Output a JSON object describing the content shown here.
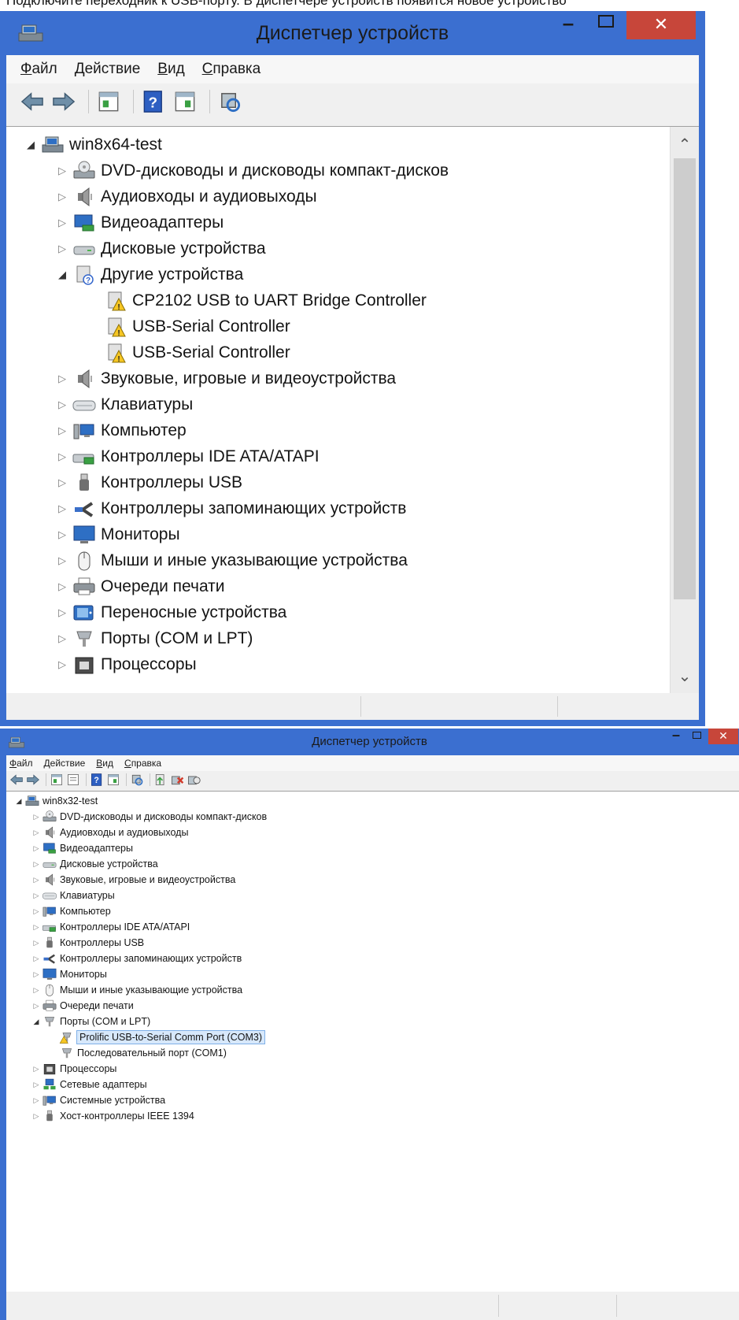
{
  "windows": [
    {
      "title": "Диспетчер устройств",
      "menu": [
        "Файл",
        "Действие",
        "Вид",
        "Справка"
      ],
      "toolbar": [
        "back-icon",
        "forward-icon",
        "sep",
        "properties-grid-icon",
        "sep",
        "help-icon",
        "view-grid-icon",
        "sep",
        "scan-hardware-icon"
      ],
      "tree": [
        {
          "label": "win8x64-test",
          "level": 0,
          "expanded": true,
          "icon": "computer-icon"
        },
        {
          "label": "DVD-дисководы и дисководы компакт-дисков",
          "level": 1,
          "expanded": false,
          "icon": "dvd-drive-icon"
        },
        {
          "label": "Аудиовходы и аудиовыходы",
          "level": 1,
          "expanded": false,
          "icon": "speaker-icon"
        },
        {
          "label": "Видеоадаптеры",
          "level": 1,
          "expanded": false,
          "icon": "display-adapter-icon"
        },
        {
          "label": "Дисковые устройства",
          "level": 1,
          "expanded": false,
          "icon": "disk-drive-icon"
        },
        {
          "label": "Другие устройства",
          "level": 1,
          "expanded": true,
          "icon": "unknown-device-icon"
        },
        {
          "label": "CP2102 USB to UART Bridge Controller",
          "level": 2,
          "expanded": null,
          "icon": "warning-device-icon"
        },
        {
          "label": "USB-Serial Controller",
          "level": 2,
          "expanded": null,
          "icon": "warning-device-icon"
        },
        {
          "label": "USB-Serial Controller",
          "level": 2,
          "expanded": null,
          "icon": "warning-device-icon"
        },
        {
          "label": "Звуковые, игровые и видеоустройства",
          "level": 1,
          "expanded": false,
          "icon": "speaker-icon"
        },
        {
          "label": "Клавиатуры",
          "level": 1,
          "expanded": false,
          "icon": "keyboard-icon"
        },
        {
          "label": "Компьютер",
          "level": 1,
          "expanded": false,
          "icon": "computer-small-icon"
        },
        {
          "label": "Контроллеры IDE ATA/ATAPI",
          "level": 1,
          "expanded": false,
          "icon": "ide-controller-icon"
        },
        {
          "label": "Контроллеры USB",
          "level": 1,
          "expanded": false,
          "icon": "usb-plug-icon"
        },
        {
          "label": "Контроллеры запоминающих устройств",
          "level": 1,
          "expanded": false,
          "icon": "storage-controller-icon"
        },
        {
          "label": "Мониторы",
          "level": 1,
          "expanded": false,
          "icon": "monitor-icon"
        },
        {
          "label": "Мыши и иные указывающие устройства",
          "level": 1,
          "expanded": false,
          "icon": "mouse-icon"
        },
        {
          "label": "Очереди печати",
          "level": 1,
          "expanded": false,
          "icon": "printer-icon"
        },
        {
          "label": "Переносные устройства",
          "level": 1,
          "expanded": false,
          "icon": "portable-device-icon"
        },
        {
          "label": "Порты (COM и LPT)",
          "level": 1,
          "expanded": false,
          "icon": "port-icon"
        },
        {
          "label": "Процессоры",
          "level": 1,
          "expanded": false,
          "icon": "processor-icon"
        }
      ]
    },
    {
      "title": "Диспетчер устройств",
      "menu": [
        "Файл",
        "Действие",
        "Вид",
        "Справка"
      ],
      "toolbar": [
        "back-icon",
        "forward-icon",
        "sep",
        "properties-grid-icon",
        "list-icon",
        "sep",
        "help-icon",
        "view-grid-icon",
        "sep",
        "scan-hardware-icon",
        "sep",
        "update-driver-icon",
        "uninstall-device-icon",
        "enable-device-icon"
      ],
      "tree": [
        {
          "label": "win8x32-test",
          "level": 0,
          "expanded": true,
          "icon": "computer-icon"
        },
        {
          "label": "DVD-дисководы и дисководы компакт-дисков",
          "level": 1,
          "expanded": false,
          "icon": "dvd-drive-icon"
        },
        {
          "label": "Аудиовходы и аудиовыходы",
          "level": 1,
          "expanded": false,
          "icon": "speaker-icon"
        },
        {
          "label": "Видеоадаптеры",
          "level": 1,
          "expanded": false,
          "icon": "display-adapter-icon"
        },
        {
          "label": "Дисковые устройства",
          "level": 1,
          "expanded": false,
          "icon": "disk-drive-icon"
        },
        {
          "label": "Звуковые, игровые и видеоустройства",
          "level": 1,
          "expanded": false,
          "icon": "speaker-icon"
        },
        {
          "label": "Клавиатуры",
          "level": 1,
          "expanded": false,
          "icon": "keyboard-icon"
        },
        {
          "label": "Компьютер",
          "level": 1,
          "expanded": false,
          "icon": "computer-small-icon"
        },
        {
          "label": "Контроллеры IDE ATA/ATAPI",
          "level": 1,
          "expanded": false,
          "icon": "ide-controller-icon"
        },
        {
          "label": "Контроллеры USB",
          "level": 1,
          "expanded": false,
          "icon": "usb-plug-icon"
        },
        {
          "label": "Контроллеры запоминающих устройств",
          "level": 1,
          "expanded": false,
          "icon": "storage-controller-icon"
        },
        {
          "label": "Мониторы",
          "level": 1,
          "expanded": false,
          "icon": "monitor-icon"
        },
        {
          "label": "Мыши и иные указывающие устройства",
          "level": 1,
          "expanded": false,
          "icon": "mouse-icon"
        },
        {
          "label": "Очереди печати",
          "level": 1,
          "expanded": false,
          "icon": "printer-icon"
        },
        {
          "label": "Порты (COM и LPT)",
          "level": 1,
          "expanded": true,
          "icon": "port-icon"
        },
        {
          "label": "Prolific USB-to-Serial Comm Port (COM3)",
          "level": 2,
          "expanded": null,
          "icon": "warning-port-icon",
          "selected": true
        },
        {
          "label": "Последовательный порт (COM1)",
          "level": 2,
          "expanded": null,
          "icon": "port-icon"
        },
        {
          "label": "Процессоры",
          "level": 1,
          "expanded": false,
          "icon": "processor-icon"
        },
        {
          "label": "Сетевые адаптеры",
          "level": 1,
          "expanded": false,
          "icon": "network-adapter-icon"
        },
        {
          "label": "Системные устройства",
          "level": 1,
          "expanded": false,
          "icon": "computer-small-icon"
        },
        {
          "label": "Хост-контроллеры IEEE 1394",
          "level": 1,
          "expanded": false,
          "icon": "usb-plug-icon"
        }
      ]
    }
  ]
}
